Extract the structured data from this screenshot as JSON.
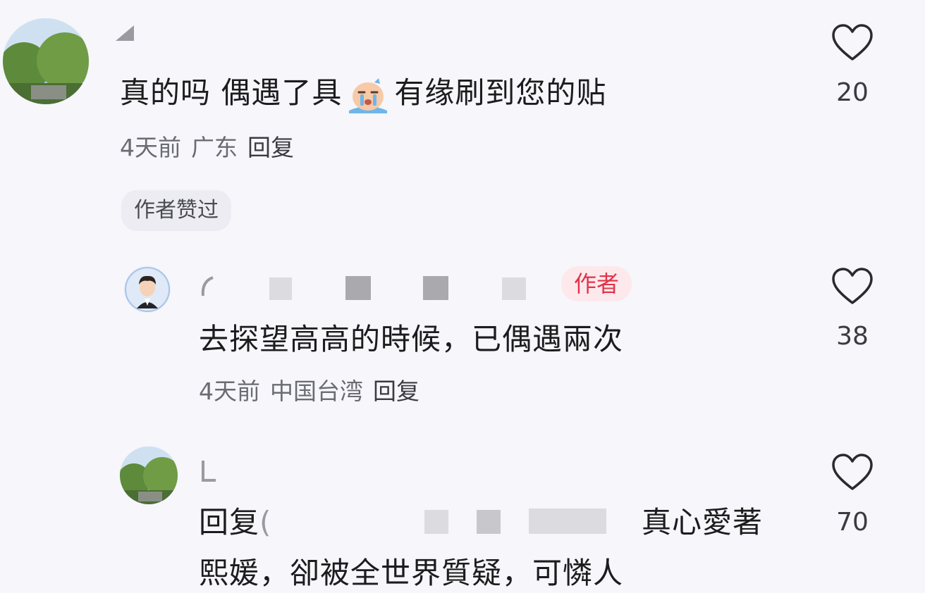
{
  "comments": [
    {
      "text_before_emoji": "真的吗 偶遇了具",
      "emoji": "crying-face",
      "text_after_emoji": "有缘刷到您的贴",
      "time": "4天前",
      "location": "广东",
      "reply_label": "回复",
      "liked_by_author_label": "作者赞过",
      "like_count": "20"
    },
    {
      "author_badge": "作者",
      "text": "去探望高高的時候，已偶遇兩次",
      "time": "4天前",
      "location": "中国台湾",
      "reply_label": "回复",
      "like_count": "38"
    },
    {
      "reply_prefix": "回复",
      "text_tail": "真心愛著",
      "text_line2": "熙媛，卻被全世界質疑，可憐人",
      "like_count": "70"
    }
  ],
  "colors": {
    "background": "#f6f6fb",
    "author_badge_bg": "#fde9ec",
    "author_badge_text": "#e0344a",
    "liked_badge_bg": "#ececf2"
  },
  "icons": {
    "like": "heart-outline-icon",
    "emoji": "crying-face"
  }
}
